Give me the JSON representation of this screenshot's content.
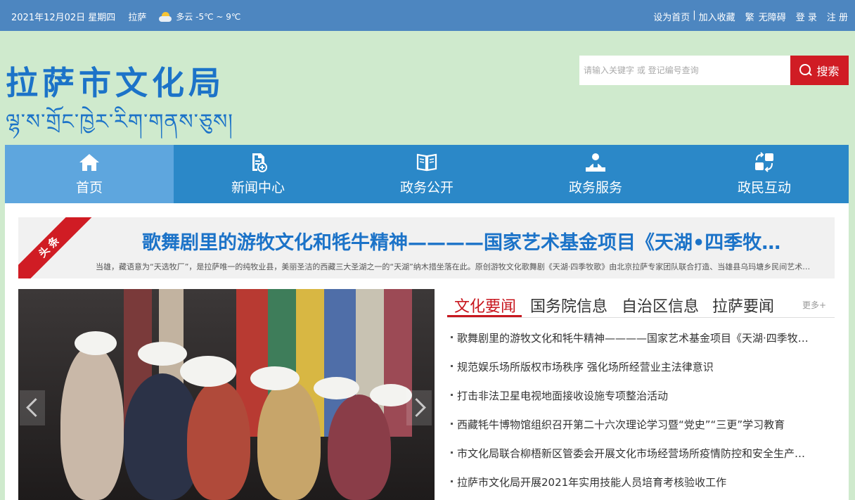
{
  "topbar": {
    "date": "2021年12月02日 星期四",
    "city": "拉萨",
    "weather": "多云 -5℃ ~ 9℃",
    "set_home": "设为首页",
    "pipe": "|",
    "add_fav": "加入收藏",
    "traditional": "繁",
    "accessibility": "无障碍",
    "login": "登 录",
    "register": "注 册"
  },
  "logo": {
    "chinese": "拉萨市文化局",
    "tibetan": "ལྷ་ས་གྲོང་ཁྱེར་རིག་གནས་ཅུས།"
  },
  "search": {
    "placeholder": "请输入关键字 或 登记编号查询",
    "button_label": "搜索"
  },
  "nav": [
    {
      "label": "首页",
      "icon": "home-icon"
    },
    {
      "label": "新闻中心",
      "icon": "news-doc-icon"
    },
    {
      "label": "政务公开",
      "icon": "open-book-icon"
    },
    {
      "label": "政务服务",
      "icon": "service-person-icon"
    },
    {
      "label": "政民互动",
      "icon": "interaction-icon"
    }
  ],
  "headline": {
    "ribbon": "头条",
    "title": "歌舞剧里的游牧文化和牦牛精神————国家艺术基金项目《天湖•四季牧歌》",
    "summary": "当雄，藏语意为“天选牧厂”，是拉萨唯一的纯牧业县，美丽圣洁的西藏三大圣湖之一的“天湖”纳木措坐落在此。原创游牧文化歌舞剧《天湖·四季牧歌》由北京拉萨专家团队联合打造、当雄县乌玛塘乡民间艺术团演出。"
  },
  "tabs": {
    "items": [
      "文化要闻",
      "国务院信息",
      "自治区信息",
      "拉萨要闻"
    ],
    "more": "更多+"
  },
  "news": [
    "歌舞剧里的游牧文化和牦牛精神————国家艺术基金项目《天湖·四季牧歌》",
    "规范娱乐场所版权市场秩序 强化场所经营业主法律意识",
    "打击非法卫星电视地面接收设施专项整治活动",
    "西藏牦牛博物馆组织召开第二十六次理论学习暨“党史”“三更”学习教育",
    "市文化局联合柳梧新区管委会开展文化市场经营场所疫情防控和安全生产检查",
    "拉萨市文化局开展2021年实用技能人员培育考核验收工作"
  ],
  "colors": {
    "topbar": "#4d86c0",
    "nav": "#2b88c8",
    "nav_active": "#5ea6de",
    "brand_blue": "#1c73c8",
    "accent_red": "#d01c24",
    "page_bg": "#cfeacd"
  }
}
